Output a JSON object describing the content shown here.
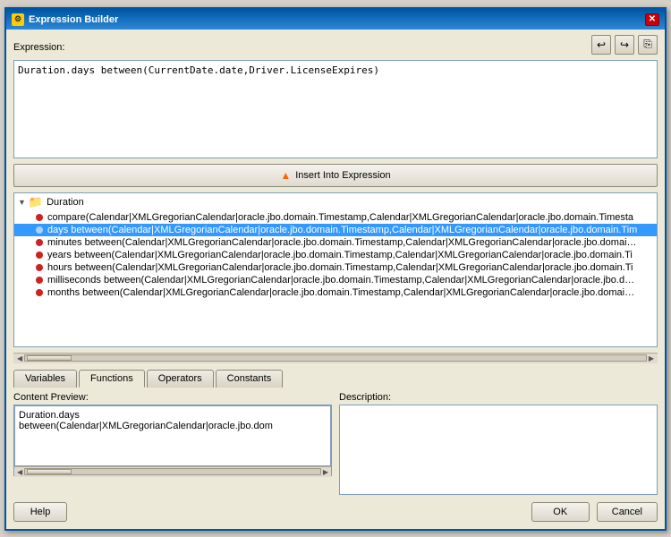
{
  "window": {
    "title": "Expression Builder",
    "icon": "⚙"
  },
  "toolbar": {
    "undo_label": "↩",
    "redo_label": "↪",
    "copy_label": "⎘"
  },
  "expression": {
    "label": "Expression:",
    "value": "Duration.days between(CurrentDate.date,Driver.LicenseExpires)"
  },
  "insert_btn": {
    "label": "Insert Into Expression",
    "icon": "▲"
  },
  "tree": {
    "folder": "Duration",
    "items": [
      "compare(Calendar|XMLGregorianCalendar|oracle.jbo.domain.Timestamp,Calendar|XMLGregorianCalendar|oracle.jbo.domain.Timesta",
      "days between(Calendar|XMLGregorianCalendar|oracle.jbo.domain.Timestamp,Calendar|XMLGregorianCalendar|oracle.jbo.domain.Tim",
      "minutes between(Calendar|XMLGregorianCalendar|oracle.jbo.domain.Timestamp,Calendar|XMLGregorianCalendar|oracle.jbo.domain.T",
      "years between(Calendar|XMLGregorianCalendar|oracle.jbo.domain.Timestamp,Calendar|XMLGregorianCalendar|oracle.jbo.domain.Ti",
      "hours between(Calendar|XMLGregorianCalendar|oracle.jbo.domain.Timestamp,Calendar|XMLGregorianCalendar|oracle.jbo.domain.Ti",
      "milliseconds between(Calendar|XMLGregorianCalendar|oracle.jbo.domain.Timestamp,Calendar|XMLGregorianCalendar|oracle.jbo.dom",
      "months between(Calendar|XMLGregorianCalendar|oracle.jbo.domain.Timestamp,Calendar|XMLGregorianCalendar|oracle.jbo.domain..."
    ],
    "selected_index": 1
  },
  "tabs": [
    {
      "label": "Variables",
      "active": false
    },
    {
      "label": "Functions",
      "active": true
    },
    {
      "label": "Operators",
      "active": false
    },
    {
      "label": "Constants",
      "active": false
    }
  ],
  "content_preview": {
    "label": "Content Preview:",
    "value": "Duration.days between(Calendar|XMLGregorianCalendar|oracle.jbo.dom"
  },
  "description": {
    "label": "Description:",
    "value": ""
  },
  "buttons": {
    "help": "Help",
    "ok": "OK",
    "cancel": "Cancel"
  }
}
